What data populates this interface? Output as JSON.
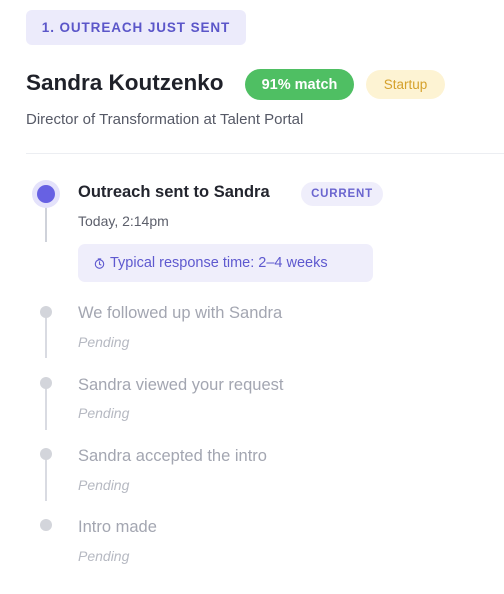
{
  "step_label": "1. OUTREACH JUST SENT",
  "profile": {
    "name": "Sandra Koutzenko",
    "match": "91% match",
    "stage": "Startup",
    "role": "Director of Transformation at Talent Portal"
  },
  "timeline": {
    "current": {
      "title": "Outreach sent to Sandra",
      "tag": "CURRENT",
      "time": "Today, 2:14pm",
      "response_time": "Typical response time: 2–4 weeks"
    },
    "pending": [
      {
        "title": "We followed up with Sandra",
        "status": "Pending"
      },
      {
        "title": "Sandra viewed your request",
        "status": "Pending"
      },
      {
        "title": "Sandra accepted the intro",
        "status": "Pending"
      },
      {
        "title": "Intro made",
        "status": "Pending"
      }
    ]
  },
  "colors": {
    "accent": "#6761e3",
    "match_green": "#4fbf63",
    "startup_yellow": "#d5a12c",
    "pending_gray": "#a3a6b1"
  },
  "icons": {
    "response_time": "clock-icon"
  }
}
